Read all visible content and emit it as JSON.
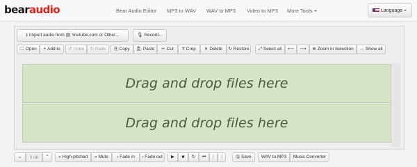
{
  "brand": {
    "part1": "bear",
    "part2": "audio"
  },
  "nav": {
    "links": [
      "Bear Audio Editor",
      "MP3 to WAV",
      "WAV to MP3",
      "Video to MP3"
    ],
    "more_tools": "More Tools",
    "language": "Language"
  },
  "import": {
    "youtube_label": "Import audio from",
    "youtube_rest": "Youtube.com or Other...",
    "record_label": "Record..."
  },
  "toolbar": {
    "open": "Open",
    "add_to": "Add to",
    "undo": "Undo",
    "redo": "Redo",
    "copy": "Copy",
    "paste": "Paste",
    "cut": "Cut",
    "crop": "Crop",
    "delete": "Delete",
    "restore": "Restore",
    "select_all": "Select all",
    "zoom_selection": "Zoom in Selection",
    "show_all": "Show all"
  },
  "drop": {
    "top_text": "Drag and drop files here",
    "bottom_text": "Drag and drop files here"
  },
  "bottom": {
    "db_value": "0 db",
    "high_pitched": "High-pitched",
    "mute": "Mute",
    "fade_in": "Fade in",
    "fade_out": "Fade out",
    "save": "Save",
    "wav_to_mp3": "WAV to MP3",
    "music_converter": "Music Converter"
  },
  "colors": {
    "brand_red": "#e2231a",
    "drop_green": "#d5e5c6",
    "drop_text": "#4a5a44"
  }
}
